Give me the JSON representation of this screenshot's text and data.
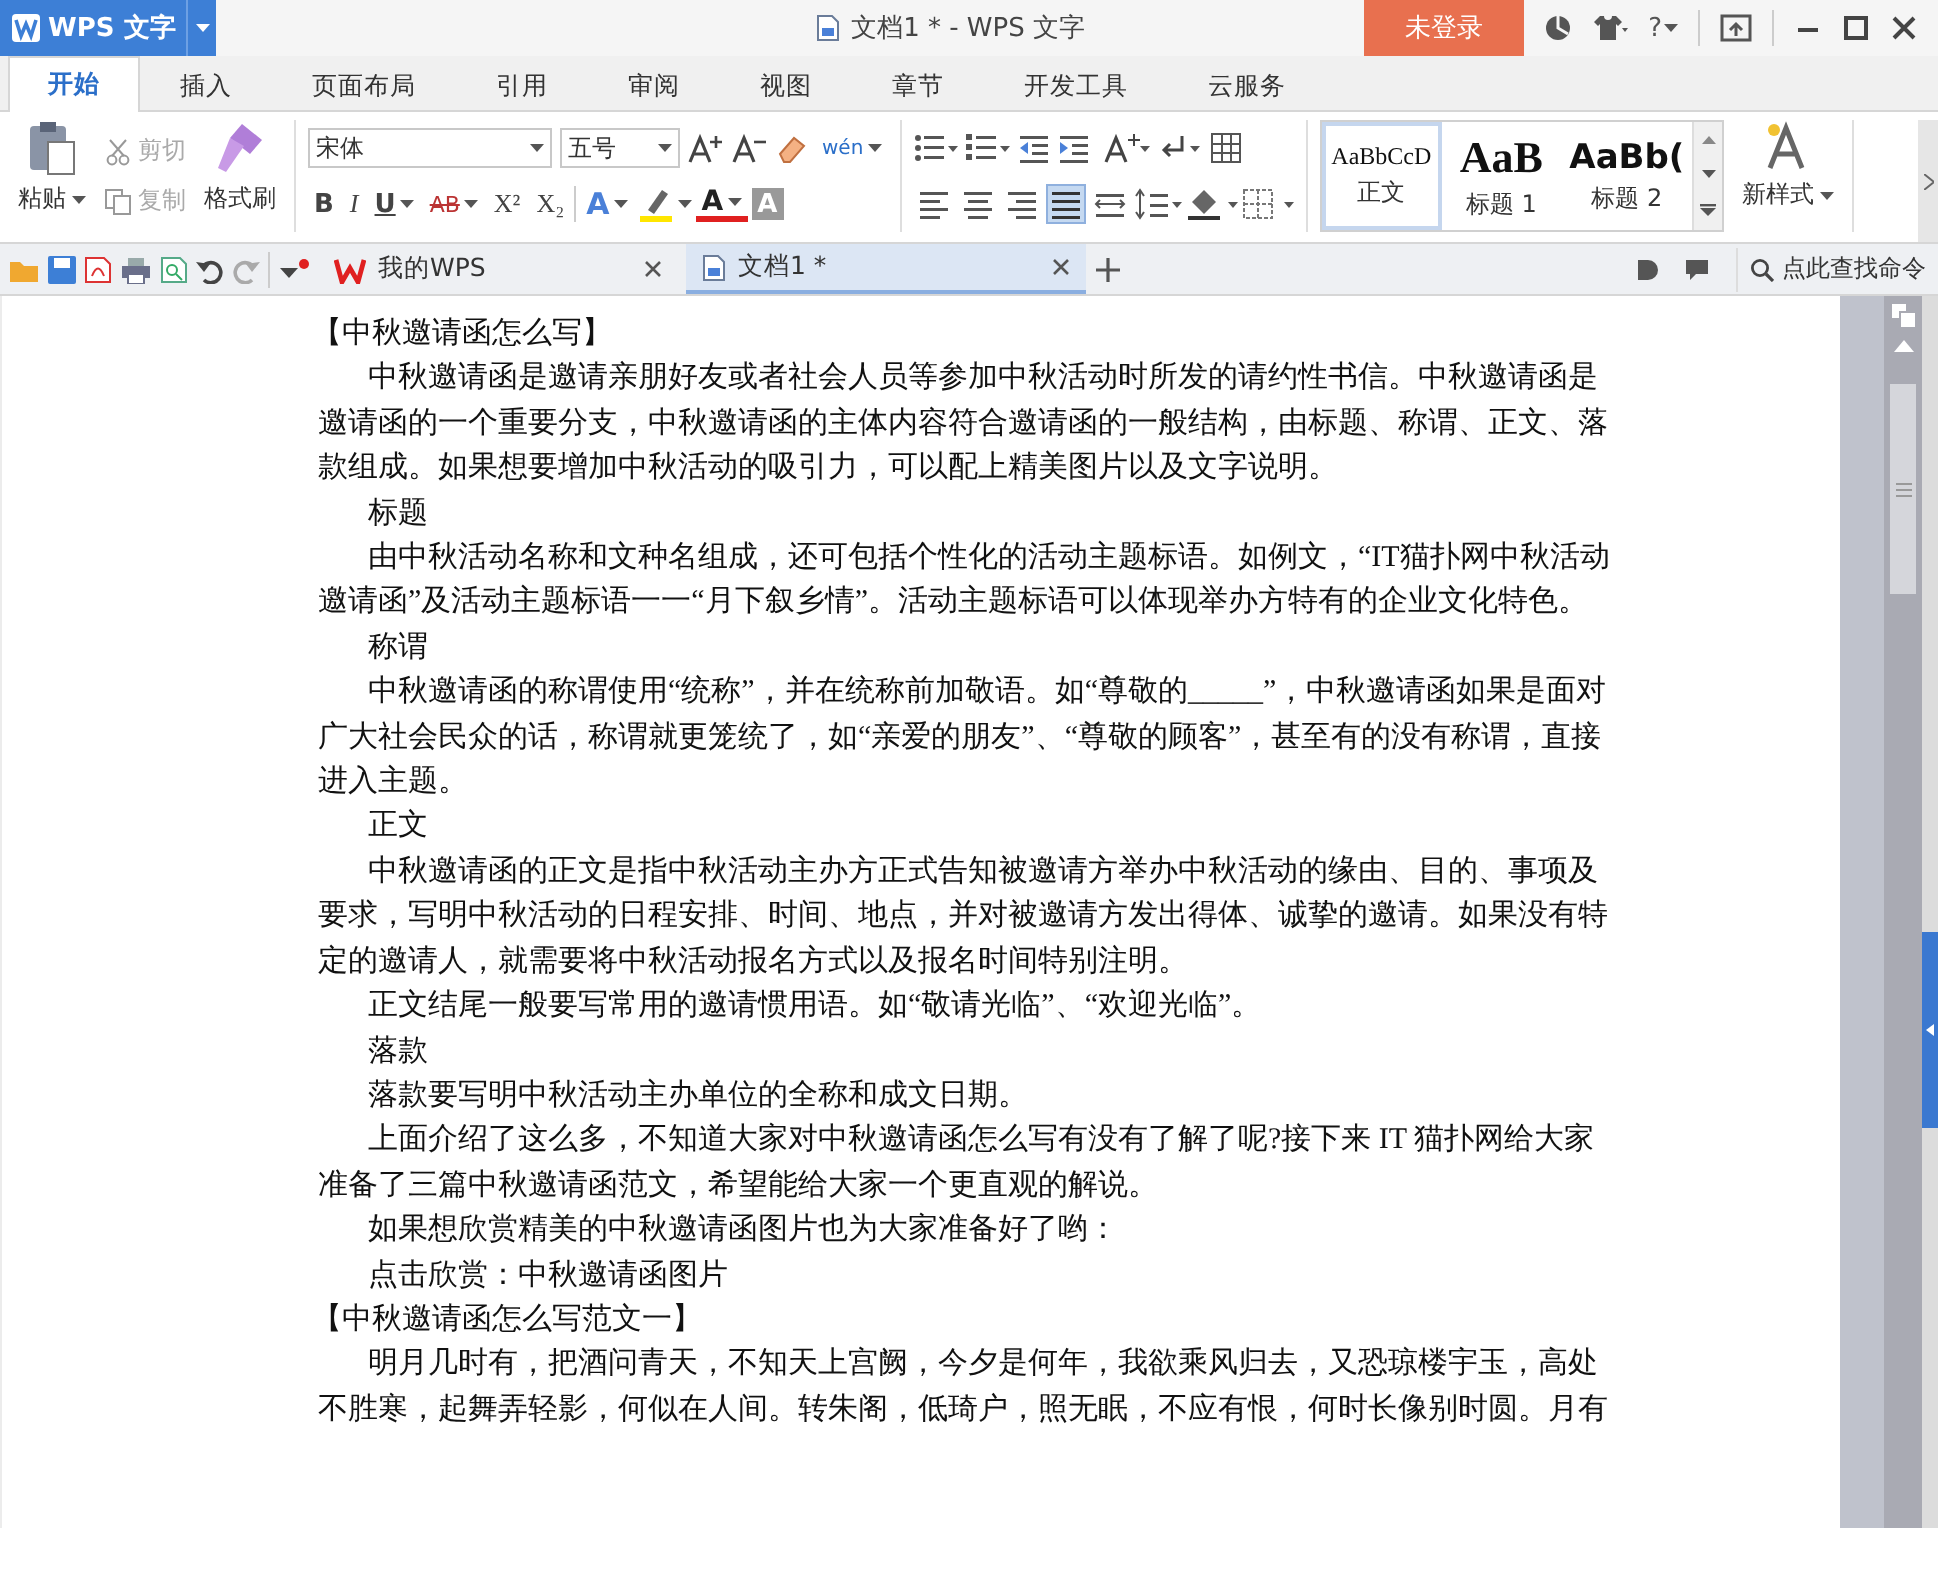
{
  "title_bar": {
    "app_name": "WPS 文字",
    "title": "文档1 * - WPS 文字",
    "login": "未登录",
    "help": "?"
  },
  "menu_tabs": [
    {
      "label": "开始",
      "selected": true
    },
    {
      "label": "插入",
      "selected": false
    },
    {
      "label": "页面布局",
      "selected": false
    },
    {
      "label": "引用",
      "selected": false
    },
    {
      "label": "审阅",
      "selected": false
    },
    {
      "label": "视图",
      "selected": false
    },
    {
      "label": "章节",
      "selected": false
    },
    {
      "label": "开发工具",
      "selected": false
    },
    {
      "label": "云服务",
      "selected": false
    }
  ],
  "ribbon": {
    "paste": "粘贴",
    "cut": {
      "label": "剪切",
      "disabled": true
    },
    "copy": {
      "label": "复制",
      "disabled": true
    },
    "format_painter": "格式刷",
    "font_name": "宋体",
    "font_size": "五号",
    "pinyin": "wén",
    "format_buttons": [
      {
        "label": "B",
        "kind": "bold",
        "dropdown": false
      },
      {
        "label": "I",
        "kind": "italic",
        "dropdown": false
      },
      {
        "label": "U",
        "kind": "underline",
        "dropdown": true
      },
      {
        "label": "AB",
        "kind": "strike",
        "dropdown": true
      },
      {
        "label": "X²",
        "kind": "plain",
        "dropdown": false
      },
      {
        "label": "X₂",
        "kind": "plain",
        "dropdown": false
      }
    ],
    "color_buttons": [
      {
        "label": "A",
        "kind": "effect",
        "dropdown": true
      },
      {
        "label": "A",
        "kind": "color",
        "dropdown": true
      },
      {
        "label": "A",
        "kind": "shade",
        "dropdown": false
      }
    ],
    "alignments": [
      {
        "kind": "left",
        "selected": false
      },
      {
        "kind": "center",
        "selected": false
      },
      {
        "kind": "right",
        "selected": false
      },
      {
        "kind": "justify",
        "selected": true
      },
      {
        "kind": "distribute",
        "selected": false
      }
    ],
    "styles": [
      {
        "sample": "AaBbCcD",
        "label": "正文",
        "kind": "body",
        "selected": true
      },
      {
        "sample": "AaB",
        "label": "标题 1",
        "kind": "h1",
        "selected": false
      },
      {
        "sample": "AaBb(",
        "label": "标题 2",
        "kind": "h2",
        "selected": false
      }
    ],
    "new_style": "新样式"
  },
  "doc_tabs": [
    {
      "label": "我的WPS",
      "kind": "home",
      "selected": false
    },
    {
      "label": "文档1 *",
      "kind": "doc",
      "selected": true
    }
  ],
  "command_search": "点此查找命令",
  "paragraphs": [
    {
      "kind": "heading",
      "text": "【中秋邀请函怎么写】"
    },
    {
      "kind": "body",
      "text": "中秋邀请函是邀请亲朋好友或者社会人员等参加中秋活动时所发的请约性书信。中秋邀请函是邀请函的一个重要分支，中秋邀请函的主体内容符合邀请函的一般结构，由标题、称谓、正文、落款组成。如果想要增加中秋活动的吸引力，可以配上精美图片以及文字说明。"
    },
    {
      "kind": "body",
      "text": "标题"
    },
    {
      "kind": "body",
      "text": "由中秋活动名称和文种名组成，还可包括个性化的活动主题标语。如例文，“IT猫扑网中秋活动邀请函”及活动主题标语一一“月下叙乡情”。活动主题标语可以体现举办方特有的企业文化特色。"
    },
    {
      "kind": "body",
      "text": "称谓"
    },
    {
      "kind": "body",
      "text": "中秋邀请函的称谓使用“统称”，并在统称前加敬语。如“尊敬的_____”，中秋邀请函如果是面对广大社会民众的话，称谓就更笼统了，如“亲爱的朋友”、“尊敬的顾客”，甚至有的没有称谓，直接进入主题。"
    },
    {
      "kind": "body",
      "text": "正文"
    },
    {
      "kind": "body",
      "text": "中秋邀请函的正文是指中秋活动主办方正式告知被邀请方举办中秋活动的缘由、目的、事项及要求，写明中秋活动的日程安排、时间、地点，并对被邀请方发出得体、诚挚的邀请。如果没有特定的邀请人，就需要将中秋活动报名方式以及报名时间特别注明。"
    },
    {
      "kind": "body",
      "text": "正文结尾一般要写常用的邀请惯用语。如“敬请光临”、“欢迎光临”。"
    },
    {
      "kind": "body",
      "text": "落款"
    },
    {
      "kind": "body",
      "text": "落款要写明中秋活动主办单位的全称和成文日期。"
    },
    {
      "kind": "body",
      "text": "上面介绍了这么多，不知道大家对中秋邀请函怎么写有没有了解了呢?接下来 IT 猫扑网给大家准备了三篇中秋邀请函范文，希望能给大家一个更直观的解说。"
    },
    {
      "kind": "body",
      "text": "如果想欣赏精美的中秋邀请函图片也为大家准备好了哟："
    },
    {
      "kind": "body",
      "text": "点击欣赏：中秋邀请函图片"
    },
    {
      "kind": "heading",
      "text": "【中秋邀请函怎么写范文一】"
    },
    {
      "kind": "body",
      "text": "明月几时有，把酒问青天，不知天上宫阙，今夕是何年，我欲乘风归去，又恐琼楼宇玉，高处不胜寒，起舞弄轻影，何似在人间。转朱阁，低琦户，照无眠，不应有恨，何时长像别时圆。月有"
    }
  ]
}
